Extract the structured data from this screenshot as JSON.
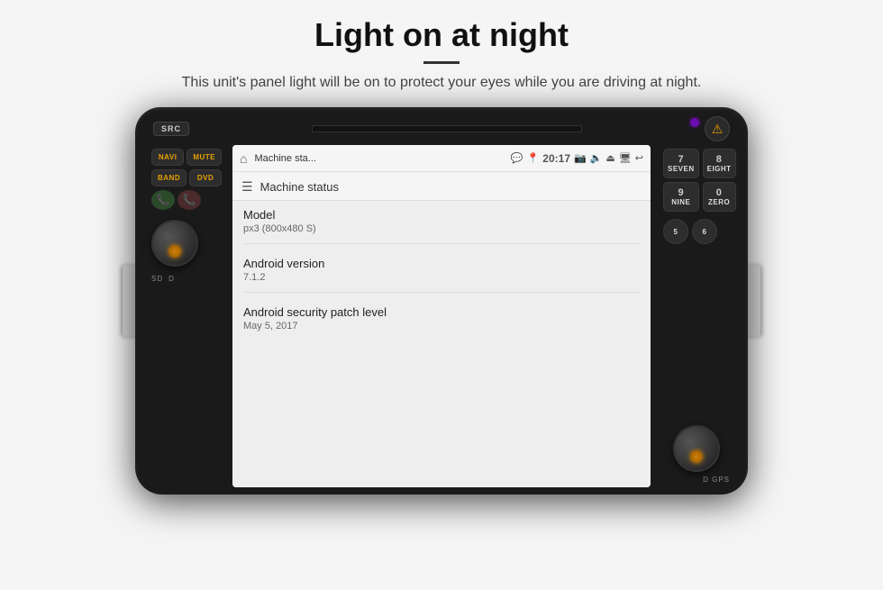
{
  "page": {
    "title": "Light on at night",
    "divider": true,
    "subtitle": "This unit's panel light will be on to protect your eyes while you are driving at night."
  },
  "headunit": {
    "src_label": "SRC",
    "status_bar": {
      "app_name": "Machine sta...",
      "time": "20:17"
    },
    "machine_status": {
      "header": "Machine status",
      "items": [
        {
          "label": "Model",
          "value": "px3 (800x480 S)"
        },
        {
          "label": "Android version",
          "value": "7.1.2"
        },
        {
          "label": "Android security patch level",
          "value": "May 5, 2017"
        }
      ]
    },
    "buttons": {
      "left": [
        "NAVI",
        "MUTE",
        "BAND",
        "DVD"
      ],
      "right_top": [
        "SEVEN",
        "EIGHT",
        "NINE",
        "ZERO"
      ],
      "right_bottom": [
        "5",
        "6"
      ]
    },
    "sd_labels": [
      "SD",
      "D"
    ],
    "gps_label": "D GPS"
  }
}
